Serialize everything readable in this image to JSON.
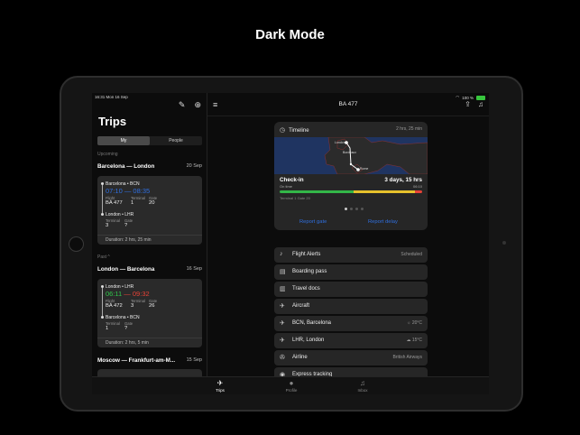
{
  "headline": "Dark Mode",
  "status": {
    "time": "16:31 Mon 16 Sep",
    "battery": "100 %"
  },
  "left": {
    "title": "Trips",
    "segments": [
      "My",
      "People"
    ],
    "upcoming_label": "Upcoming",
    "past_label": "Past ^",
    "trips": [
      {
        "route": "Barcelona — London",
        "date": "20 Sep",
        "from": "Barcelona • BCN",
        "times": "07:10 — 08:35",
        "flight_hdr": "Flight",
        "terminal_hdr": "Terminal",
        "gate_hdr": "Gate",
        "flight": "BA 477",
        "terminal": "1",
        "gate": "20",
        "to": "London • LHR",
        "to_terminal": "3",
        "to_gate": "?",
        "duration": "Duration: 2 hrs, 25 min"
      },
      {
        "route": "London — Barcelona",
        "date": "16 Sep",
        "from": "London • LHR",
        "times_a": "06:11",
        "times_sep": " — ",
        "times_b": "09:32",
        "flight_hdr": "Flight",
        "terminal_hdr": "Terminal",
        "gate_hdr": "Gate",
        "flight": "BA 472",
        "terminal": "3",
        "gate": "26",
        "to": "Barcelona • BCN",
        "to_terminal": "1",
        "to_gate": "?",
        "duration": "Duration: 2 hrs, 5 min"
      },
      {
        "route": "Moscow — Frankfurt-am-M...",
        "date": "15 Sep"
      }
    ]
  },
  "right": {
    "title": "BA 477",
    "timeline": {
      "label": "Timeline",
      "duration": "2 hrs, 25 min",
      "map_labels": [
        "London",
        "Bordeaux",
        "Rome"
      ],
      "checkin": "Check-in",
      "checkin_status": "On time",
      "countdown": "3 days, 15 hrs",
      "countdown_time": "06:10",
      "progress": 0.95,
      "terminal_gate": "Terminal 1 Gate 20",
      "report_gate": "Report gate",
      "report_delay": "Report delay"
    },
    "rows": [
      {
        "icon": "bell-icon",
        "label": "Flight Alerts",
        "right": "Scheduled"
      },
      {
        "icon": "pass-icon",
        "label": "Boarding pass",
        "right": ""
      },
      {
        "icon": "docs-icon",
        "label": "Travel docs",
        "right": ""
      },
      {
        "icon": "plane-icon",
        "label": "Aircraft",
        "right": ""
      },
      {
        "icon": "takeoff-icon",
        "label": "BCN, Barcelona",
        "right": "20°C"
      },
      {
        "icon": "landing-icon",
        "label": "LHR, London",
        "right": "15°C"
      },
      {
        "icon": "airline-icon",
        "label": "Airline",
        "right": "British Airways"
      },
      {
        "icon": "tracking-icon",
        "label": "Express tracking",
        "right": ""
      }
    ]
  },
  "tabs": [
    "Trips",
    "Profile",
    "Inbox"
  ]
}
